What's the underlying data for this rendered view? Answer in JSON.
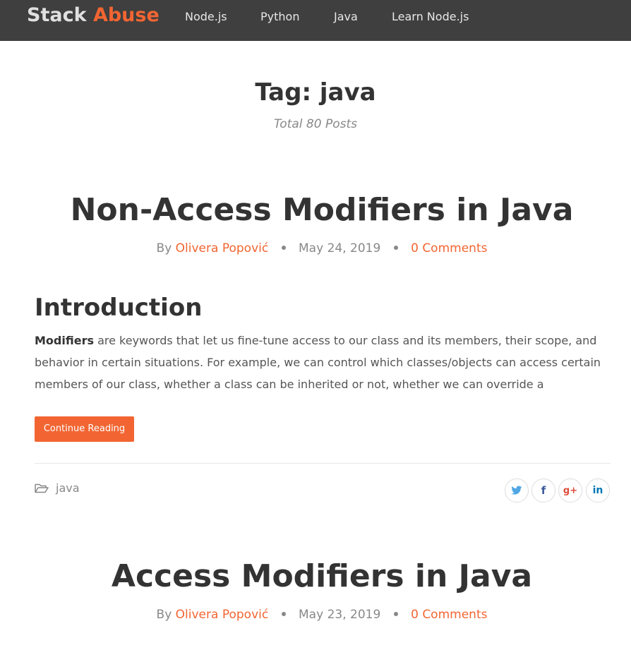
{
  "navbar": {
    "brand_part1": "Stack",
    "brand_part2": "Abuse",
    "links": [
      "Node.js",
      "Python",
      "Java",
      "Learn Node.js"
    ]
  },
  "tag": {
    "title": "Tag: java",
    "subtitle": "Total 80 Posts"
  },
  "posts": [
    {
      "title": "Non-Access Modifiers in Java",
      "by": "By",
      "author": "Olivera Popović",
      "date": "May 24, 2019",
      "comments": "0 Comments",
      "heading": "Introduction",
      "excerpt_bold": "Modifiers",
      "excerpt_rest": " are keywords that let us fine-tune access to our class and its members, their scope, and behavior in certain situations. For example, we can control which classes/objects can access certain members of our class, whether a class can be inherited or not, whether we can override a",
      "button_label": "Continue Reading",
      "category": "java",
      "share": {
        "twitter": "𝕥",
        "facebook": "f",
        "google": "g+",
        "linkedin": "in"
      }
    },
    {
      "title": "Access Modifiers in Java",
      "by": "By",
      "author": "Olivera Popović",
      "date": "May 23, 2019",
      "comments": "0 Comments"
    }
  ],
  "colors": {
    "accent": "#f26532",
    "navbar_bg": "#3f3f3f",
    "muted_text": "#888888",
    "twitter": "#1da1f2",
    "facebook": "#3b5998",
    "google": "#dd4b39",
    "linkedin": "#0077b5"
  },
  "icons": {
    "category": "folder-open-icon",
    "twitter": "twitter-icon",
    "facebook": "facebook-icon",
    "google": "google-plus-icon",
    "linkedin": "linkedin-icon"
  }
}
